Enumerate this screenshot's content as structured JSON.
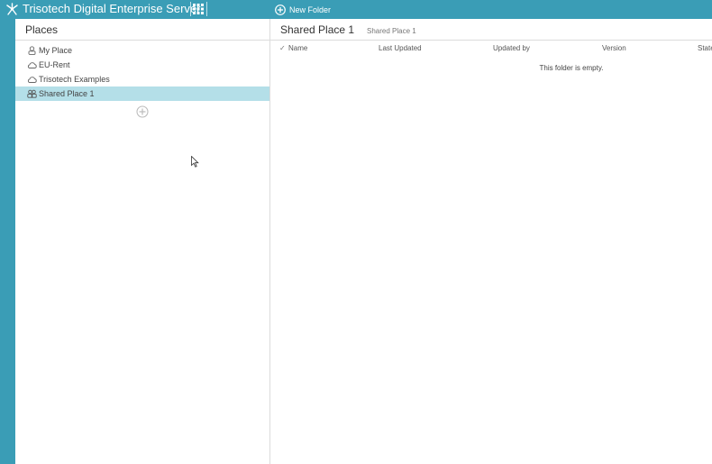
{
  "app": {
    "title": "Trisotech Digital Enterprise Server",
    "icons": {
      "logo": "trisotech-logo-icon",
      "apps": "apps-grid-icon"
    }
  },
  "toolbar": {
    "new_folder_label": "New Folder",
    "new_folder_icon": "plus-circle-icon"
  },
  "places": {
    "title": "Places",
    "items": [
      {
        "label": "My Place",
        "icon": "person-icon",
        "selected": false
      },
      {
        "label": "EU-Rent",
        "icon": "cloud-icon",
        "selected": false
      },
      {
        "label": "Trisotech Examples",
        "icon": "cloud-icon",
        "selected": false
      },
      {
        "label": "Shared Place 1",
        "icon": "group-icon",
        "selected": true
      }
    ],
    "add_icon": "add-place-icon"
  },
  "content": {
    "folder_title": "Shared Place 1",
    "breadcrumb": "Shared Place 1",
    "columns": [
      "Name",
      "Last Updated",
      "Updated by",
      "Version",
      "State"
    ],
    "sort_indicator": "✓",
    "empty_message": "This folder is empty."
  },
  "colors": {
    "brand": "#3a9db6",
    "selected_row": "#b4dfe8",
    "divider": "#dcdcdc"
  }
}
